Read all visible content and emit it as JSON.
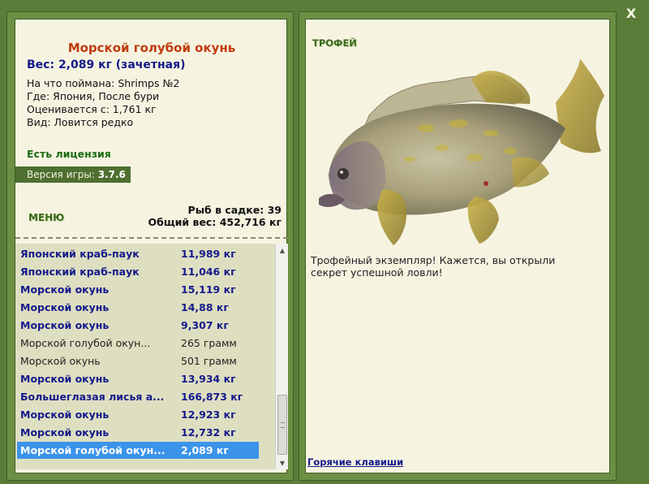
{
  "window": {
    "close_label": "X"
  },
  "fish": {
    "title": "Морской голубой окунь",
    "weight_line": "Вес: 2,089 кг (зачетная)",
    "info": [
      "На что поймана: Shrimps №2",
      "Где: Япония, После бури",
      "Оценивается с: 1,761 кг",
      "Вид: Ловится редко"
    ],
    "license": "Есть лицензия"
  },
  "version": {
    "label": "Версия игры:",
    "value": "3.7.6"
  },
  "menu": {
    "label": "МЕНЮ"
  },
  "summary": {
    "count_line": "Рыб в садке: 39",
    "total_line": "Общий вес: 452,716 кг"
  },
  "catch_list": [
    {
      "name": "Японский краб-паук",
      "weight": "11,989 кг",
      "style": "trophy"
    },
    {
      "name": "Японский краб-паук",
      "weight": "11,046 кг",
      "style": "trophy"
    },
    {
      "name": "Морской окунь",
      "weight": "15,119 кг",
      "style": "trophy"
    },
    {
      "name": "Морской окунь",
      "weight": "14,88 кг",
      "style": "trophy"
    },
    {
      "name": "Морской окунь",
      "weight": "9,307 кг",
      "style": "trophy"
    },
    {
      "name": "Морской голубой окун...",
      "weight": "265 грамм",
      "style": "normal"
    },
    {
      "name": "Морской окунь",
      "weight": "501 грамм",
      "style": "normal"
    },
    {
      "name": "Морской окунь",
      "weight": "13,934 кг",
      "style": "trophy"
    },
    {
      "name": "Большеглазая лисья а...",
      "weight": "166,873 кг",
      "style": "trophy"
    },
    {
      "name": "Морской окунь",
      "weight": "12,923 кг",
      "style": "trophy"
    },
    {
      "name": "Морской окунь",
      "weight": "12,732 кг",
      "style": "trophy"
    },
    {
      "name": "Морской голубой окун...",
      "weight": "2,089 кг",
      "style": "selected"
    }
  ],
  "trophy": {
    "label": "ТРОФЕЙ",
    "description": "Трофейный экземпляр! Кажется, вы открыли секрет успешной ловли!"
  },
  "hotkeys": {
    "label": "Горячие клавиши"
  },
  "colors": {
    "frame": "#6b8f45",
    "panel": "#f6f4e1",
    "title": "#c03a0c",
    "trophy_text": "#141a8a",
    "selected": "#3b93ea"
  }
}
